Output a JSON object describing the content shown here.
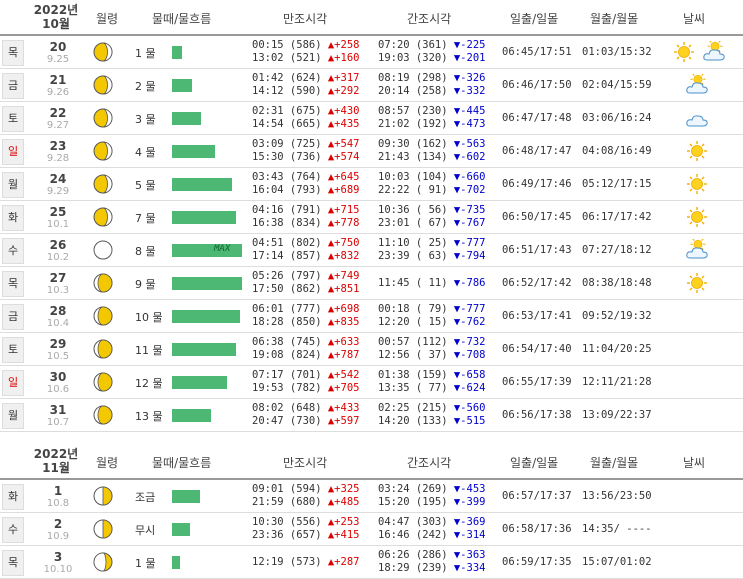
{
  "headers": {
    "moon": "월령",
    "mul": "물때/물흐름",
    "high": "만조시각",
    "low": "간조시각",
    "sun": "일출/일몰",
    "moonrise": "월출/월몰",
    "weather": "날씨"
  },
  "sections": [
    {
      "year": "2022년",
      "month": "10월",
      "rows": [
        {
          "dow": "목",
          "red": false,
          "day": "20",
          "lunar": "9.25",
          "phase": "waxing",
          "mul": "1 물",
          "bar": 0.14,
          "high1": "00:15 (586) ",
          "high1d": "▲+258",
          "high2": "13:02 (521) ",
          "high2d": "▲+160",
          "low1": "07:20 (361) ",
          "low1d": "▼-225",
          "low2": "19:03 (320) ",
          "low2d": "▼-201",
          "sun": "06:45/17:51",
          "mr": "01:03/15:32",
          "wx": [
            "sun",
            "partly"
          ]
        },
        {
          "dow": "금",
          "red": false,
          "day": "21",
          "lunar": "9.26",
          "phase": "waxing",
          "mul": "2 물",
          "bar": 0.28,
          "high1": "01:42 (624) ",
          "high1d": "▲+317",
          "high2": "14:12 (590) ",
          "high2d": "▲+292",
          "low1": "08:19 (298) ",
          "low1d": "▼-326",
          "low2": "20:14 (258) ",
          "low2d": "▼-332",
          "sun": "06:46/17:50",
          "mr": "02:04/15:59",
          "wx": [
            "partly"
          ]
        },
        {
          "dow": "토",
          "red": false,
          "day": "22",
          "lunar": "9.27",
          "phase": "waxing",
          "mul": "3 물",
          "bar": 0.42,
          "high1": "02:31 (675) ",
          "high1d": "▲+430",
          "high2": "14:54 (665) ",
          "high2d": "▲+435",
          "low1": "08:57 (230) ",
          "low1d": "▼-445",
          "low2": "21:02 (192) ",
          "low2d": "▼-473",
          "sun": "06:47/17:48",
          "mr": "03:06/16:24",
          "wx": [
            "cloud"
          ]
        },
        {
          "dow": "일",
          "red": true,
          "day": "23",
          "lunar": "9.28",
          "phase": "waxing",
          "mul": "4 물",
          "bar": 0.62,
          "high1": "03:09 (725) ",
          "high1d": "▲+547",
          "high2": "15:30 (736) ",
          "high2d": "▲+574",
          "low1": "09:30 (162) ",
          "low1d": "▼-563",
          "low2": "21:43 (134) ",
          "low2d": "▼-602",
          "sun": "06:48/17:47",
          "mr": "04:08/16:49",
          "wx": [
            "sun"
          ]
        },
        {
          "dow": "월",
          "red": false,
          "day": "24",
          "lunar": "9.29",
          "phase": "waxing",
          "mul": "5 물",
          "bar": 0.86,
          "high1": "03:43 (764) ",
          "high1d": "▲+645",
          "high2": "16:04 (793) ",
          "high2d": "▲+689",
          "low1": "10:03 (104) ",
          "low1d": "▼-660",
          "low2": "22:22 ( 91) ",
          "low2d": "▼-702",
          "sun": "06:49/17:46",
          "mr": "05:12/17:15",
          "wx": [
            "sun"
          ]
        },
        {
          "dow": "화",
          "red": false,
          "day": "25",
          "lunar": "10.1",
          "phase": "waxing",
          "mul": "7 물",
          "bar": 0.92,
          "high1": "04:16 (791) ",
          "high1d": "▲+715",
          "high2": "16:38 (834) ",
          "high2d": "▲+778",
          "low1": "10:36 ( 56) ",
          "low1d": "▼-735",
          "low2": "23:01 ( 67) ",
          "low2d": "▼-767",
          "sun": "06:50/17:45",
          "mr": "06:17/17:42",
          "wx": [
            "sun"
          ]
        },
        {
          "dow": "수",
          "red": false,
          "day": "26",
          "lunar": "10.2",
          "phase": "new",
          "mul": "8 물",
          "bar": 1.0,
          "max": "MAX",
          "high1": "04:51 (802) ",
          "high1d": "▲+750",
          "high2": "17:14 (857) ",
          "high2d": "▲+832",
          "low1": "11:10 ( 25) ",
          "low1d": "▼-777",
          "low2": "23:39 ( 63) ",
          "low2d": "▼-794",
          "sun": "06:51/17:43",
          "mr": "07:27/18:12",
          "wx": [
            "partly"
          ]
        },
        {
          "dow": "목",
          "red": false,
          "day": "27",
          "lunar": "10.3",
          "phase": "waning",
          "mul": "9 물",
          "bar": 1.0,
          "high1": "05:26 (797) ",
          "high1d": "▲+749",
          "high2": "17:50 (862) ",
          "high2d": "▲+851",
          "low1": "11:45 ( 11) ",
          "low1d": "▼-786",
          "low2": "",
          "low2d": "",
          "sun": "06:52/17:42",
          "mr": "08:38/18:48",
          "wx": [
            "sun"
          ]
        },
        {
          "dow": "금",
          "red": false,
          "day": "28",
          "lunar": "10.4",
          "phase": "waning",
          "mul": "10 물",
          "bar": 0.97,
          "high1": "06:01 (777) ",
          "high1d": "▲+698",
          "high2": "18:28 (850) ",
          "high2d": "▲+835",
          "low1": "00:18 ( 79) ",
          "low1d": "▼-777",
          "low2": "12:20 ( 15) ",
          "low2d": "▼-762",
          "sun": "06:53/17:41",
          "mr": "09:52/19:32",
          "wx": []
        },
        {
          "dow": "토",
          "red": false,
          "day": "29",
          "lunar": "10.5",
          "phase": "waning",
          "mul": "11 물",
          "bar": 0.92,
          "high1": "06:38 (745) ",
          "high1d": "▲+633",
          "high2": "19:08 (824) ",
          "high2d": "▲+787",
          "low1": "00:57 (112) ",
          "low1d": "▼-732",
          "low2": "12:56 ( 37) ",
          "low2d": "▼-708",
          "sun": "06:54/17:40",
          "mr": "11:04/20:25",
          "wx": []
        },
        {
          "dow": "일",
          "red": true,
          "day": "30",
          "lunar": "10.6",
          "phase": "waning",
          "mul": "12 물",
          "bar": 0.78,
          "high1": "07:17 (701) ",
          "high1d": "▲+542",
          "high2": "19:53 (782) ",
          "high2d": "▲+705",
          "low1": "01:38 (159) ",
          "low1d": "▼-658",
          "low2": "13:35 ( 77) ",
          "low2d": "▼-624",
          "sun": "06:55/17:39",
          "mr": "12:11/21:28",
          "wx": []
        },
        {
          "dow": "월",
          "red": false,
          "day": "31",
          "lunar": "10.7",
          "phase": "waning",
          "mul": "13 물",
          "bar": 0.56,
          "high1": "08:02 (648) ",
          "high1d": "▲+433",
          "high2": "20:47 (730) ",
          "high2d": "▲+597",
          "low1": "02:25 (215) ",
          "low1d": "▼-560",
          "low2": "14:20 (133) ",
          "low2d": "▼-515",
          "sun": "06:56/17:38",
          "mr": "13:09/22:37",
          "wx": []
        }
      ]
    },
    {
      "year": "2022년",
      "month": "11월",
      "rows": [
        {
          "dow": "화",
          "red": false,
          "day": "1",
          "lunar": "10.8",
          "phase": "half",
          "mul": "조금",
          "bar": 0.4,
          "high1": "09:01 (594) ",
          "high1d": "▲+325",
          "high2": "21:59 (680) ",
          "high2d": "▲+485",
          "low1": "03:24 (269) ",
          "low1d": "▼-453",
          "low2": "15:20 (195) ",
          "low2d": "▼-399",
          "sun": "06:57/17:37",
          "mr": "13:56/23:50",
          "wx": []
        },
        {
          "dow": "수",
          "red": false,
          "day": "2",
          "lunar": "10.9",
          "phase": "half",
          "mul": "무시",
          "bar": 0.26,
          "high1": "10:30 (556) ",
          "high1d": "▲+253",
          "high2": "23:36 (657) ",
          "high2d": "▲+415",
          "low1": "04:47 (303) ",
          "low1d": "▼-369",
          "low2": "16:46 (242) ",
          "low2d": "▼-314",
          "sun": "06:58/17:36",
          "mr": "14:35/ ----",
          "wx": []
        },
        {
          "dow": "목",
          "red": false,
          "day": "3",
          "lunar": "10.10",
          "phase": "gibbous",
          "mul": "1 물",
          "bar": 0.12,
          "high1": "12:19 (573) ",
          "high1d": "▲+287",
          "high2": "",
          "high2d": "",
          "low1": "06:26 (286) ",
          "low1d": "▼-363",
          "low2": "18:29 (239) ",
          "low2d": "▼-334",
          "sun": "06:59/17:35",
          "mr": "15:07/01:02",
          "wx": []
        }
      ]
    }
  ]
}
